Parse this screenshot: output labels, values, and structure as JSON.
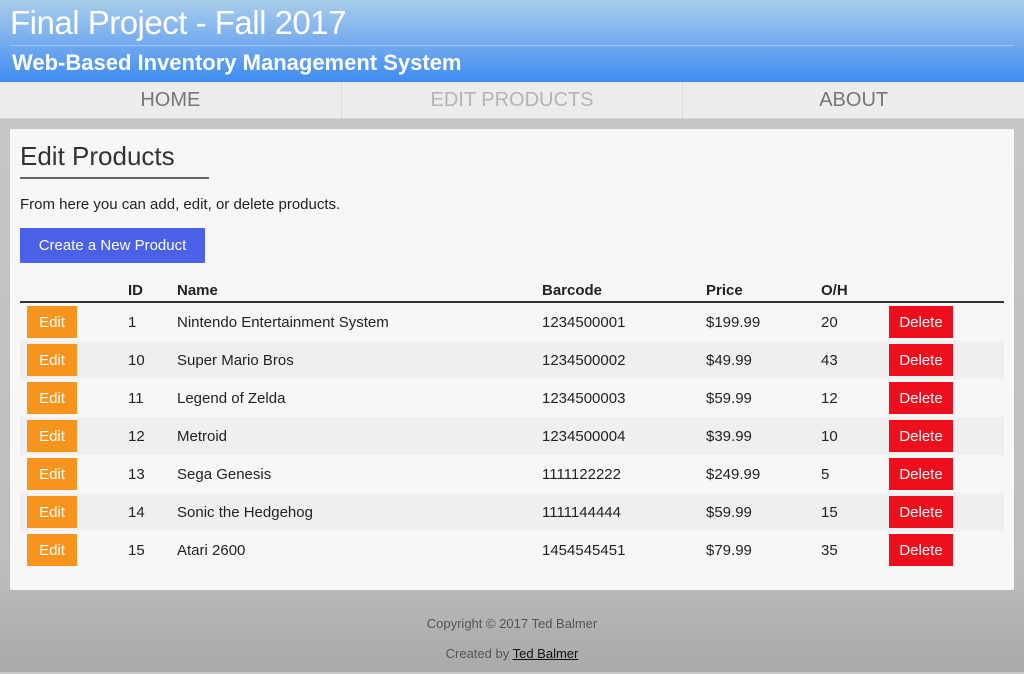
{
  "header": {
    "title": "Final Project - Fall 2017",
    "subtitle": "Web-Based Inventory Management System"
  },
  "nav": {
    "items": [
      {
        "label": "HOME"
      },
      {
        "label": "EDIT PRODUCTS"
      },
      {
        "label": "ABOUT"
      }
    ]
  },
  "main": {
    "heading": "Edit Products",
    "intro": "From here you can add, edit, or delete products.",
    "create_button": "Create a New Product",
    "columns": [
      "",
      "ID",
      "Name",
      "Barcode",
      "Price",
      "O/H",
      ""
    ],
    "edit_label": "Edit",
    "delete_label": "Delete",
    "rows": [
      {
        "id": "1",
        "name": "Nintendo Entertainment System",
        "barcode": "1234500001",
        "price": "$199.99",
        "oh": "20"
      },
      {
        "id": "10",
        "name": "Super Mario Bros",
        "barcode": "1234500002",
        "price": "$49.99",
        "oh": "43"
      },
      {
        "id": "11",
        "name": "Legend of Zelda",
        "barcode": "1234500003",
        "price": "$59.99",
        "oh": "12"
      },
      {
        "id": "12",
        "name": "Metroid",
        "barcode": "1234500004",
        "price": "$39.99",
        "oh": "10"
      },
      {
        "id": "13",
        "name": "Sega Genesis",
        "barcode": "1111122222",
        "price": "$249.99",
        "oh": "5"
      },
      {
        "id": "14",
        "name": "Sonic the Hedgehog",
        "barcode": "1111144444",
        "price": "$59.99",
        "oh": "15"
      },
      {
        "id": "15",
        "name": "Atari 2600",
        "barcode": "1454545451",
        "price": "$79.99",
        "oh": "35"
      }
    ]
  },
  "footer": {
    "copyright": "Copyright © 2017 Ted Balmer",
    "created_by": "Created by",
    "author": "Ted Balmer"
  },
  "colors": {
    "create_button": "#4a60e6",
    "edit_button": "#f7941d",
    "delete_button": "#ee0f1d",
    "header_gradient_end": "#3f8cf2"
  }
}
